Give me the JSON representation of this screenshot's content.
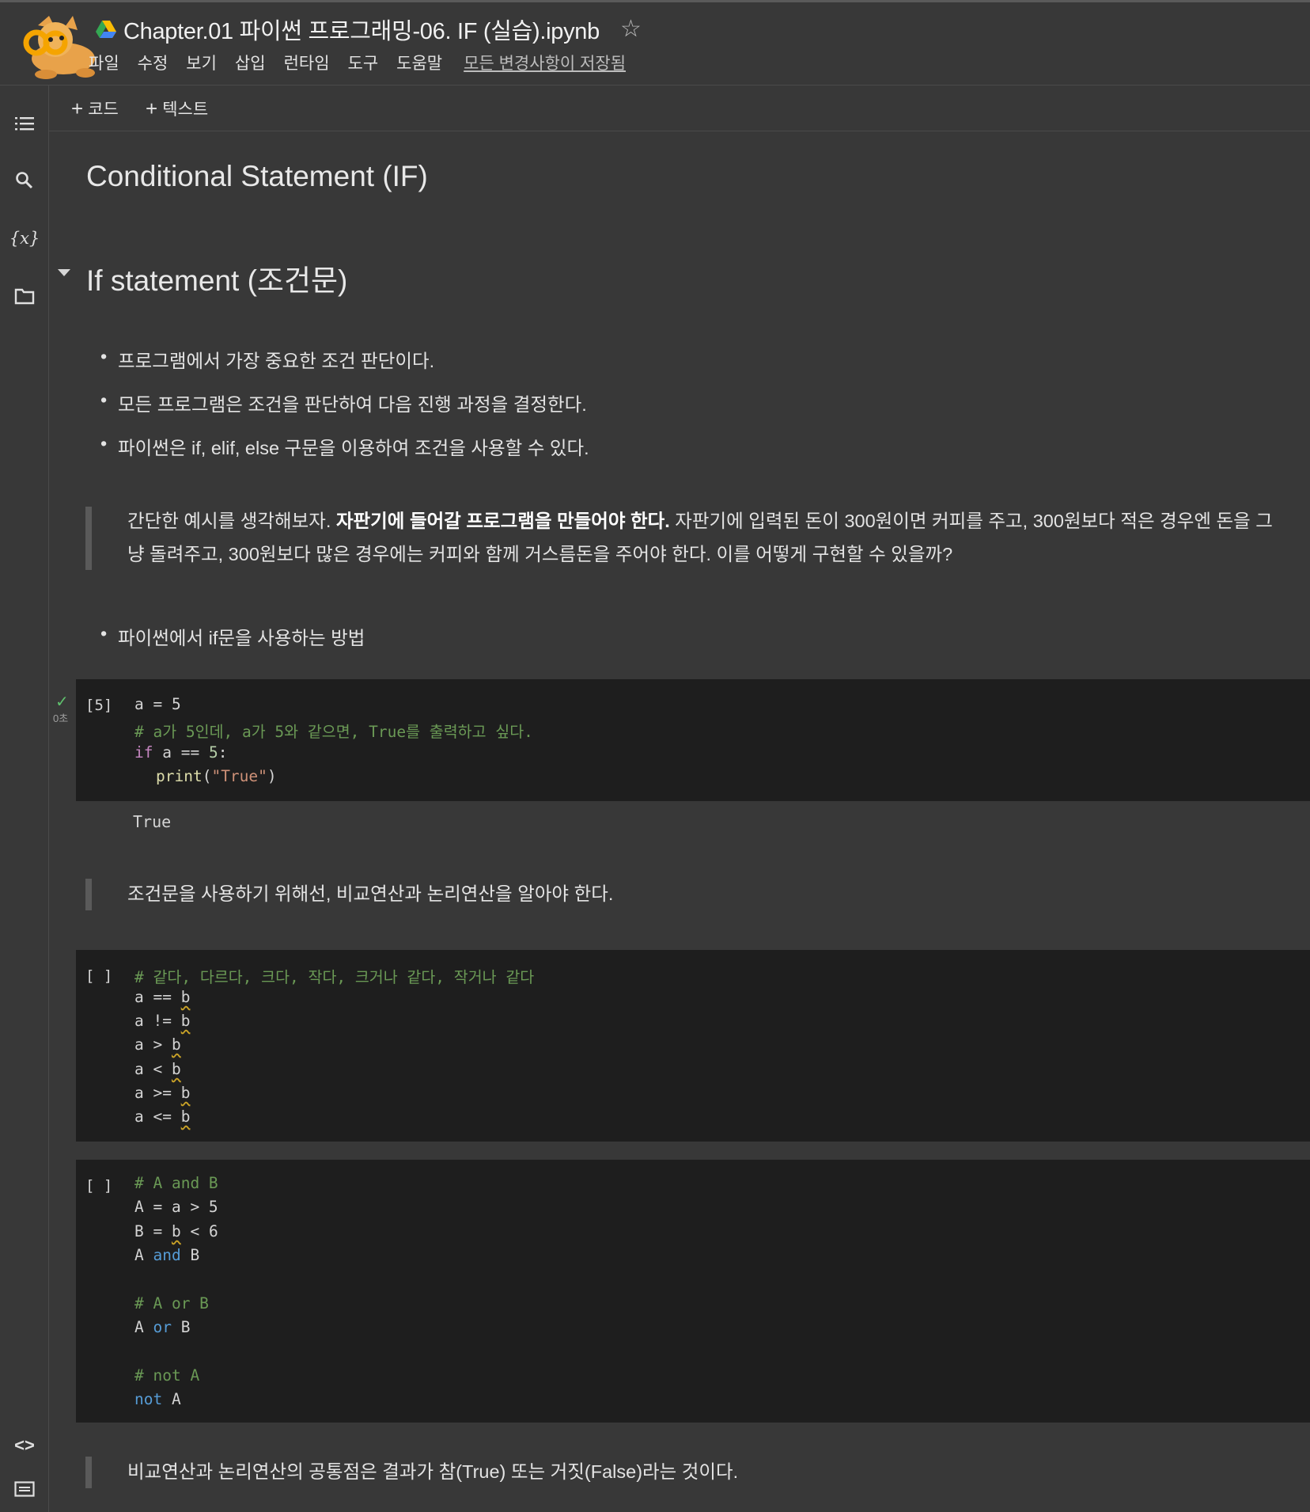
{
  "header": {
    "doc_title": "Chapter.01 파이썬 프로그래밍-06. IF (실습).ipynb",
    "star_icon": "star-outline-icon",
    "menu": [
      "파일",
      "수정",
      "보기",
      "삽입",
      "런타임",
      "도구",
      "도움말"
    ],
    "save_status": "모든 변경사항이 저장됨"
  },
  "sidebar": {
    "icons": [
      "table-of-contents-icon",
      "search-icon",
      "variables-icon",
      "folder-icon",
      "code-snippets-icon",
      "terminal-icon"
    ]
  },
  "toolbar": {
    "add_code": "코드",
    "add_text": "텍스트"
  },
  "notebook": {
    "main_title": "Conditional Statement (IF)",
    "section_title": "If statement (조건문)",
    "bullets": [
      "프로그램에서 가장 중요한 조건 판단이다.",
      "모든 프로그램은 조건을 판단하여 다음 진행 과정을 결정한다.",
      "파이썬은 if, elif, else 구문을 이용하여 조건을 사용할 수 있다."
    ],
    "quote1": {
      "pre": "간단한 예시를 생각해보자. ",
      "bold": "자판기에 들어갈 프로그램을 만들어야 한다.",
      "post": " 자판기에 입력된 돈이 300원이면 커피를 주고, 300원보다 적은 경우엔 돈을 그냥 돌려주고, 300원보다 많은 경우에는 커피와 함께 거스름돈을 주어야 한다. 이를 어떻게 구현할 수 있을까?"
    },
    "bullet_howto": "파이썬에서 if문을 사용하는 방법",
    "cell1": {
      "prompt": "[5]",
      "run_time": "0초",
      "line1": "a = 5",
      "comment": "# a가 5인데, a가 5와 같으면, True를 출력하고 싶다.",
      "if_kw": "if",
      "if_rest": " a == ",
      "if_num": "5",
      "if_colon": ":",
      "print_fn": "print",
      "print_arg": "\"True\"",
      "output": "True"
    },
    "quote2": "조건문을 사용하기 위해선, 비교연산과 논리연산을 알아야 한다.",
    "cell2": {
      "prompt": "[ ]",
      "comment": "# 같다, 다르다, 크다, 작다, 크거나 같다, 작거나 같다",
      "ops": [
        "a == ",
        "a != ",
        "a > ",
        "a < ",
        "a >= ",
        "a <= "
      ],
      "var": "b"
    },
    "cell3": {
      "prompt": "[ ]",
      "c1": "# A and B",
      "l1": "A = a > 5",
      "l2a": "B = ",
      "l2b": "b",
      "l2c": " < 6",
      "l3a": "A ",
      "l3b": "and",
      "l3c": " B",
      "c2": "# A or B",
      "l4a": "A ",
      "l4b": "or",
      "l4c": " B",
      "c3": "# not A",
      "l5a": "not",
      "l5b": " A"
    },
    "quote3": "비교연산과 논리연산의 공통점은 결과가 참(True) 또는 거짓(False)라는 것이다."
  }
}
